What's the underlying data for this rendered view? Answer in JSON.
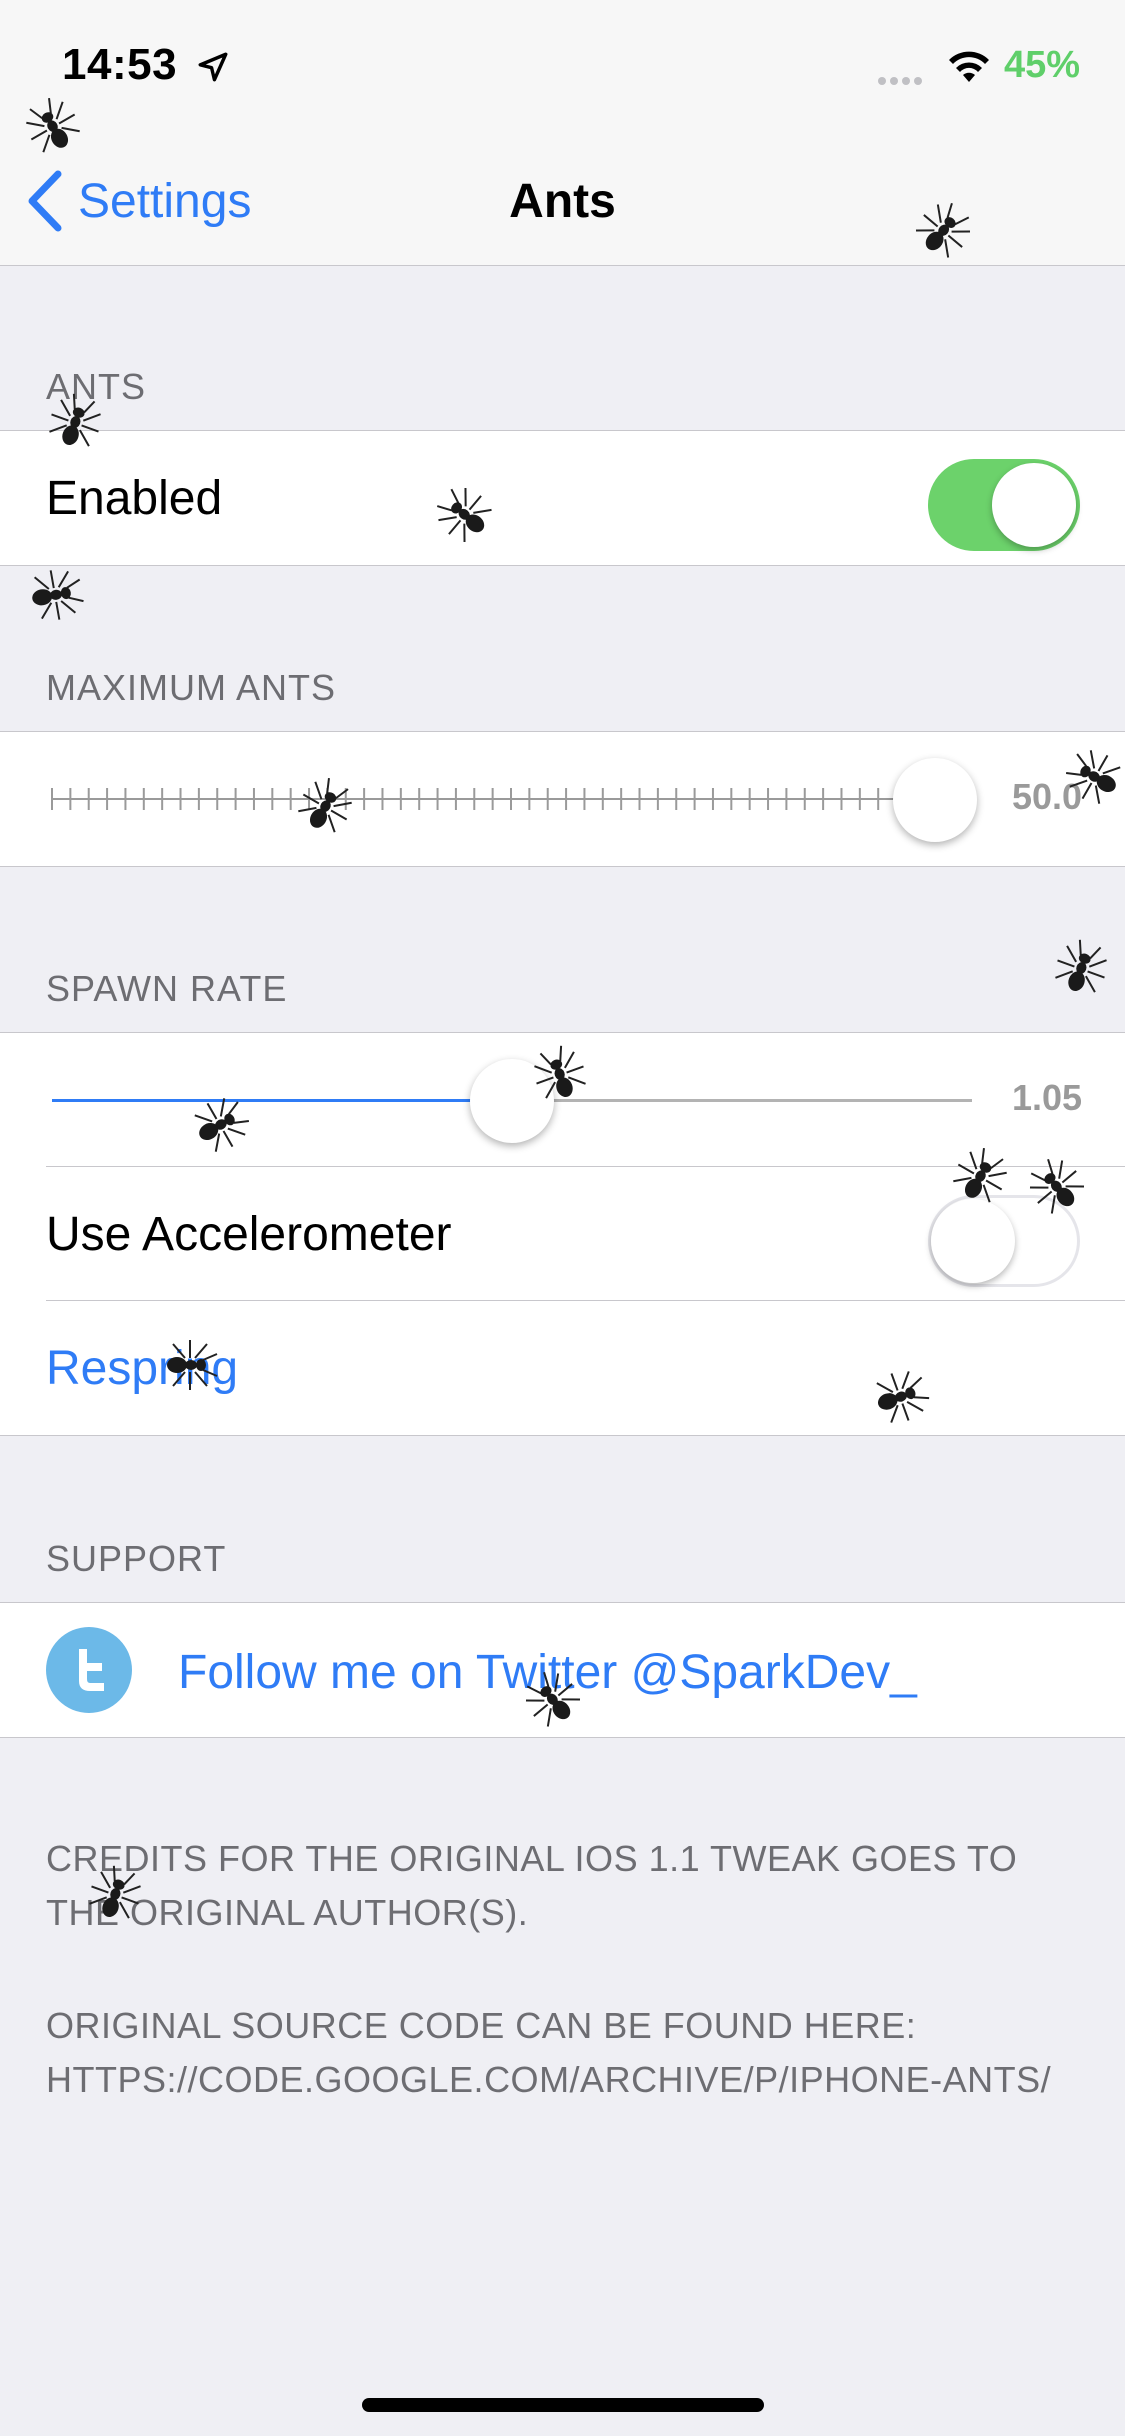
{
  "status_bar": {
    "time": "14:53",
    "battery": "45%"
  },
  "nav": {
    "back_label": "Settings",
    "title": "Ants"
  },
  "sections": {
    "ants_header": "ANTS",
    "enabled_label": "Enabled",
    "enabled_on": true,
    "max_header": "MAXIMUM ANTS",
    "max_value": "50.0",
    "max_fraction": 0.96,
    "spawn_header": "SPAWN RATE",
    "spawn_value": "1.05",
    "spawn_fraction": 0.5,
    "accelerometer_label": "Use Accelerometer",
    "accelerometer_on": false,
    "respring_label": "Respring",
    "support_header": "SUPPORT",
    "twitter_label": "Follow me on Twitter @SparkDev_"
  },
  "footer": {
    "credits": "CREDITS FOR THE ORIGINAL IOS 1.1 TWEAK GOES TO THE ORIGINAL AUTHOR(S).",
    "source": "ORIGINAL SOURCE CODE CAN BE FOUND HERE: HTTPS://CODE.GOOGLE.COM/ARCHIVE/P/IPHONE-ANTS/"
  },
  "colors": {
    "accent": "#2f7cf6",
    "toggle_on": "#6cd26b",
    "twitter": "#6cb9e8",
    "battery": "#5fcf6a"
  },
  "icons": [
    "location-arrow-icon",
    "wifi-icon",
    "chevron-left-icon",
    "twitter-bird-icon",
    "ant-icon"
  ]
}
